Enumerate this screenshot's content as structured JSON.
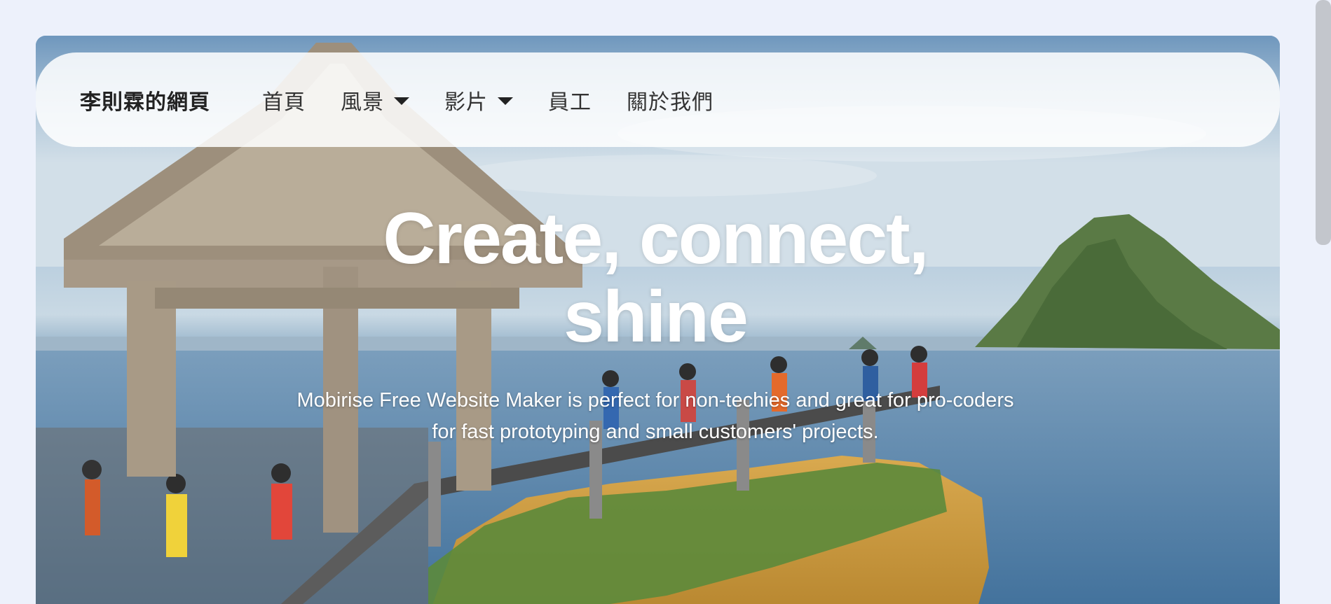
{
  "navbar": {
    "brand": "李則霖的網頁",
    "items": [
      {
        "label": "首頁",
        "has_dropdown": false
      },
      {
        "label": "風景",
        "has_dropdown": true
      },
      {
        "label": "影片",
        "has_dropdown": true
      },
      {
        "label": "員工",
        "has_dropdown": false
      },
      {
        "label": "關於我們",
        "has_dropdown": false
      }
    ]
  },
  "hero": {
    "headline_line1": "Create, connect,",
    "headline_line2": "shine",
    "subtitle": "Mobirise Free Website Maker is perfect for non-techies and great for pro-coders for fast prototyping and small customers' projects."
  },
  "icons": {
    "dropdown": "chevron-down-icon"
  },
  "colors": {
    "page_background": "#edf1fb",
    "navbar_background": "#ffffff",
    "headline_text": "#ffffff"
  }
}
